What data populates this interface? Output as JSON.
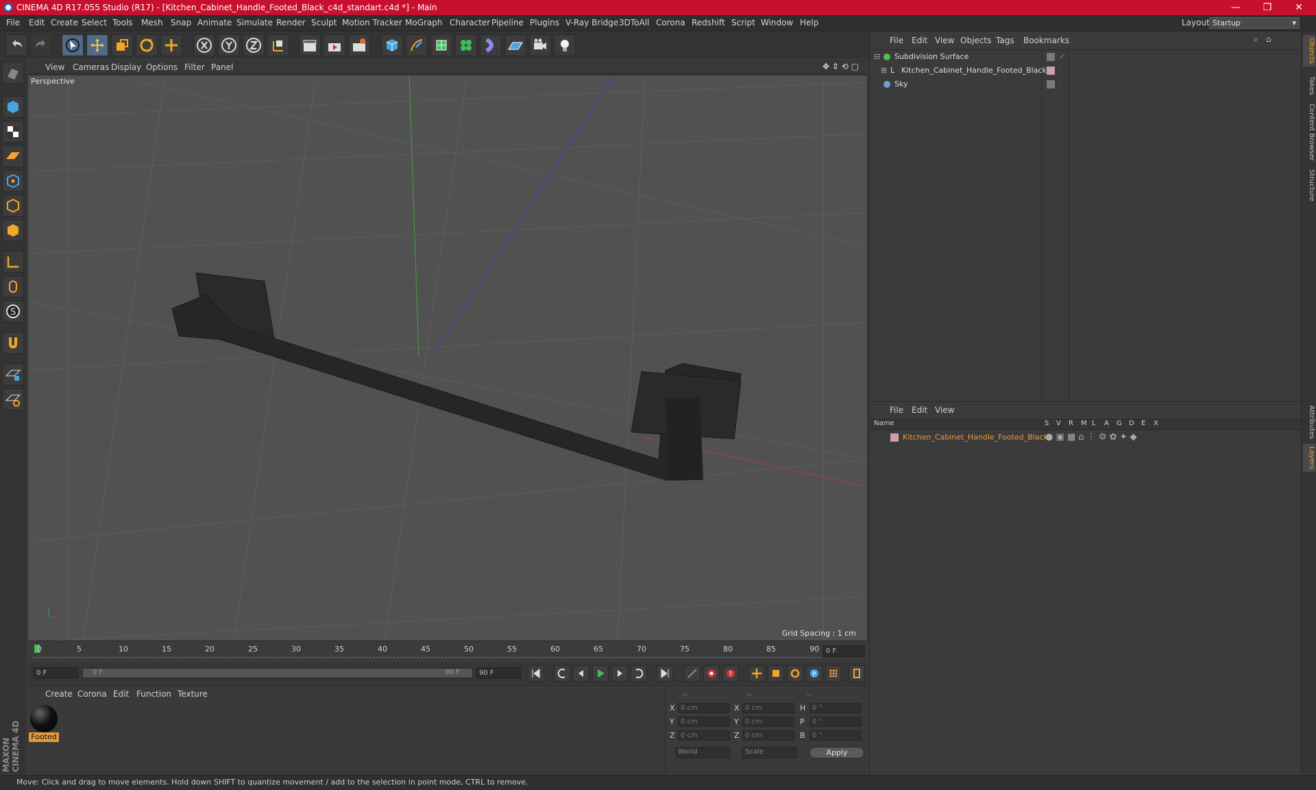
{
  "titlebar": {
    "title": "CINEMA 4D R17.055 Studio (R17) - [Kitchen_Cabinet_Handle_Footed_Black_c4d_standart.c4d *] - Main",
    "min": "—",
    "max": "❐",
    "close": "✕"
  },
  "menu": [
    "File",
    "Edit",
    "Create",
    "Select",
    "Tools",
    "Mesh",
    "Snap",
    "Animate",
    "Simulate",
    "Render",
    "Sculpt",
    "Motion Tracker",
    "MoGraph",
    "Character",
    "Pipeline",
    "Plugins",
    "V-Ray Bridge",
    "3DToAll",
    "Corona",
    "Redshift",
    "Script",
    "Window",
    "Help"
  ],
  "layout": {
    "label": "Layout:",
    "value": "Startup"
  },
  "viewport": {
    "menu": [
      "View",
      "Cameras",
      "Display",
      "Options",
      "Filter",
      "Panel"
    ],
    "label": "Perspective",
    "grid": "Grid Spacing : 1 cm"
  },
  "timeline": {
    "ticks": [
      "0",
      "5",
      "10",
      "15",
      "20",
      "25",
      "30",
      "35",
      "40",
      "45",
      "50",
      "55",
      "60",
      "65",
      "70",
      "75",
      "80",
      "85",
      "90"
    ],
    "current": "0 F",
    "start": "0 F",
    "range_start": "0 F",
    "range_end": "90 F",
    "end": "90 F"
  },
  "material": {
    "menu": [
      "Create",
      "Corona",
      "Edit",
      "Function",
      "Texture"
    ],
    "items": [
      {
        "name": "Footed"
      }
    ]
  },
  "coords": {
    "headers": [
      "--",
      "--",
      "--"
    ],
    "rows": [
      {
        "a": "X",
        "av": "0 cm",
        "b": "X",
        "bv": "0 cm",
        "c": "H",
        "cv": "0 °"
      },
      {
        "a": "Y",
        "av": "0 cm",
        "b": "Y",
        "bv": "0 cm",
        "c": "P",
        "cv": "0 °"
      },
      {
        "a": "Z",
        "av": "0 cm",
        "b": "Z",
        "bv": "0 cm",
        "c": "B",
        "cv": "0 °"
      }
    ],
    "mode1": "World",
    "mode2": "Scale",
    "apply": "Apply"
  },
  "objects": {
    "menu": [
      "File",
      "Edit",
      "View",
      "Objects",
      "Tags",
      "Bookmarks"
    ],
    "items": [
      {
        "name": "Subdivision Surface",
        "color": "#4fbf4f"
      },
      {
        "name": "Kitchen_Cabinet_Handle_Footed_Black",
        "color": "#cfa0a8"
      },
      {
        "name": "Sky",
        "color": "#6f9fd8"
      }
    ]
  },
  "layers": {
    "menu": [
      "File",
      "Edit",
      "View"
    ],
    "columns": [
      "Name",
      "S",
      "V",
      "R",
      "M",
      "L",
      "A",
      "G",
      "D",
      "E",
      "X"
    ],
    "items": [
      {
        "name": "Kitchen_Cabinet_Handle_Footed_Black",
        "color": "#e39c3c"
      }
    ]
  },
  "right_tabs": [
    "Objects",
    "Takes",
    "Content Browser",
    "Structure",
    "Attributes",
    "Layers"
  ],
  "status": "Move: Click and drag to move elements. Hold down SHIFT to quantize movement / add to the selection in point mode, CTRL to remove.",
  "brand": "MAXON CINEMA 4D",
  "colors": {
    "title_bar": "#c8102e",
    "accent_selected": "#e39c3c",
    "viewport_bg": "#515151"
  }
}
